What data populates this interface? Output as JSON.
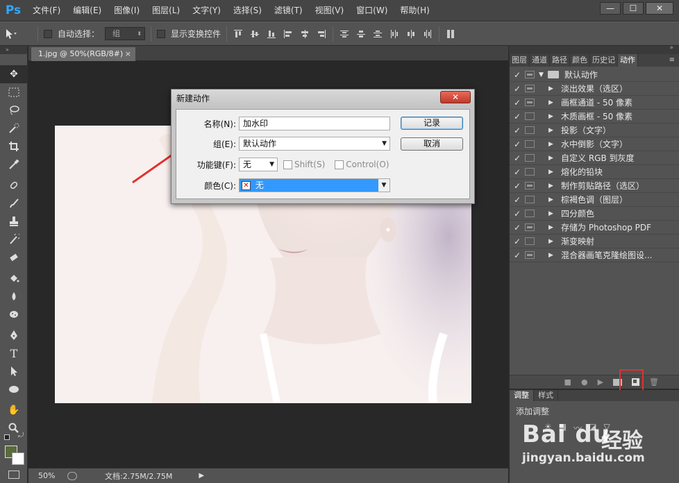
{
  "app": {
    "logo": "Ps",
    "menu": [
      "文件(F)",
      "编辑(E)",
      "图像(I)",
      "图层(L)",
      "文字(Y)",
      "选择(S)",
      "滤镜(T)",
      "视图(V)",
      "窗口(W)",
      "帮助(H)"
    ],
    "window_controls": [
      "—",
      "☐",
      "✕"
    ]
  },
  "options_bar": {
    "auto_select_label": "自动选择：",
    "auto_select_value": "组",
    "show_transform_label": "显示变换控件"
  },
  "document": {
    "tab_title": "1.jpg @ 50%(RGB/8#)",
    "tab_close": "×",
    "zoom": "50%",
    "doc_size": "文档:2.75M/2.75M"
  },
  "dialog": {
    "title": "新建动作",
    "close": "✕",
    "name_label": "名称(N):",
    "name_value": "加水印",
    "set_label": "组(E):",
    "set_value": "默认动作",
    "fkey_label": "功能键(F):",
    "fkey_value": "无",
    "shift_label": "Shift(S)",
    "control_label": "Control(O)",
    "color_label": "颜色(C):",
    "color_value": "无",
    "color_swatch": "✕",
    "record_button": "记录",
    "cancel_button": "取消"
  },
  "panels": {
    "tabs": [
      "图层",
      "通道",
      "路径",
      "颜色",
      "历史记",
      "动作"
    ],
    "active_tab": "动作",
    "action_set": "默认动作",
    "actions": [
      {
        "label": "淡出效果（选区）",
        "dialog": true
      },
      {
        "label": "画框通道 - 50 像素",
        "dialog": true
      },
      {
        "label": "木质画框 - 50 像素",
        "dialog": false
      },
      {
        "label": "投影（文字）",
        "dialog": false
      },
      {
        "label": "水中倒影（文字）",
        "dialog": false
      },
      {
        "label": "自定义 RGB 到灰度",
        "dialog": false
      },
      {
        "label": "熔化的铅块",
        "dialog": false
      },
      {
        "label": "制作剪贴路径（选区）",
        "dialog": true
      },
      {
        "label": "棕褐色调（图层）",
        "dialog": false
      },
      {
        "label": "四分颜色",
        "dialog": false
      },
      {
        "label": "存储为 Photoshop PDF",
        "dialog": true
      },
      {
        "label": "渐变映射",
        "dialog": false
      },
      {
        "label": "混合器画笔克隆绘图设...",
        "dialog": true
      }
    ],
    "adjust_tabs": [
      "调整",
      "样式"
    ],
    "adjust_title": "添加调整"
  },
  "watermark": {
    "brand": "Bai du",
    "suffix": "经验",
    "url": "jingyan.baidu.com"
  },
  "colors": {
    "accent": "#31a8ff",
    "highlight_red": "#e23030",
    "foreground_swatch": "#5a6b3c"
  }
}
